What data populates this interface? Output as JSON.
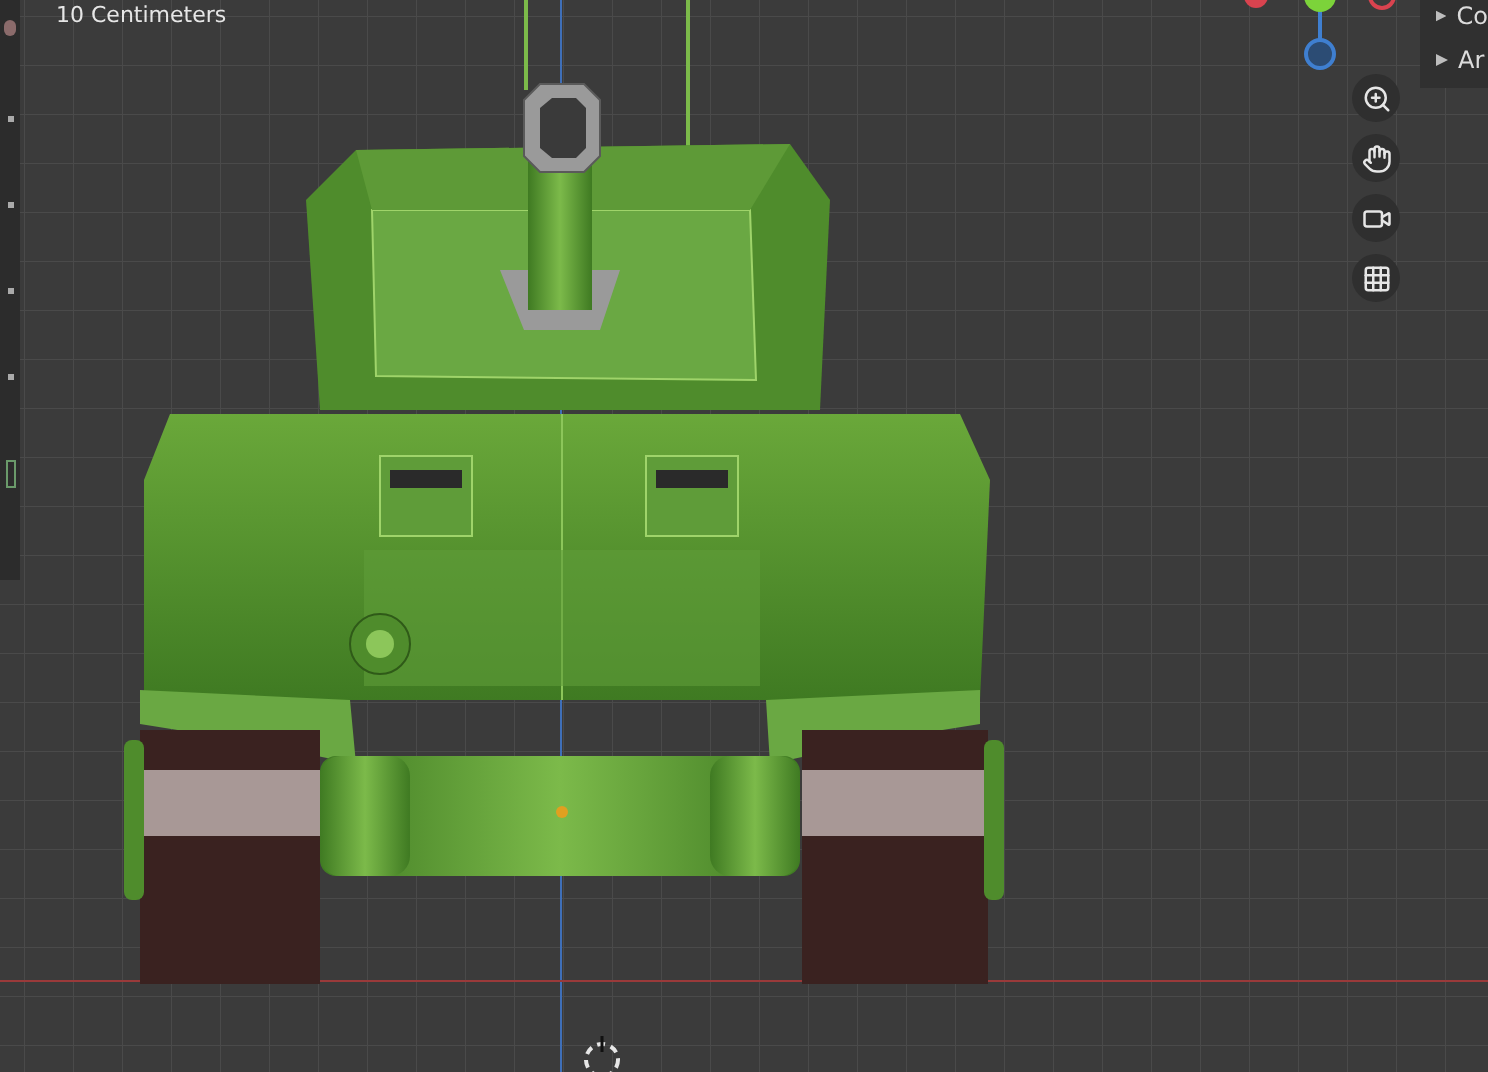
{
  "viewport": {
    "scale_label": "10 Centimeters"
  },
  "navigation_buttons": [
    {
      "kind": "zoom"
    },
    {
      "kind": "pan"
    },
    {
      "kind": "camera"
    },
    {
      "kind": "grid"
    }
  ],
  "outliner": {
    "items": [
      {
        "label": "Co",
        "expanded": false
      },
      {
        "label": "Ar",
        "expanded": false
      }
    ]
  }
}
